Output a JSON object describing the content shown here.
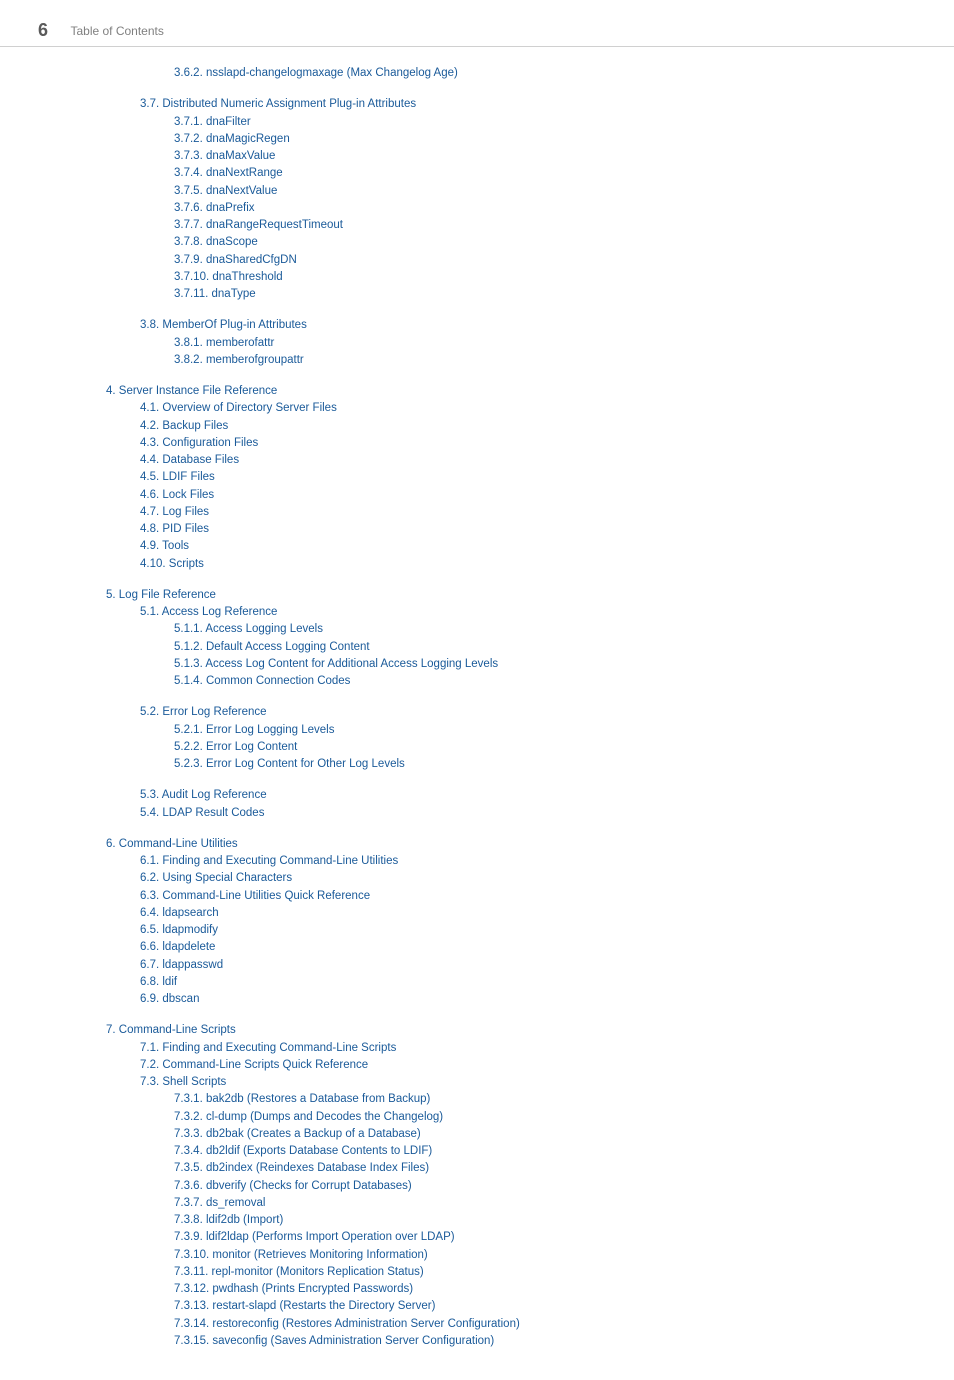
{
  "header": {
    "page_number": "6",
    "title": "Table of Contents"
  },
  "toc": [
    {
      "indent": 3,
      "gap": false,
      "text": "3.6.2. nsslapd-changelogmaxage (Max Changelog Age)"
    },
    {
      "indent": 2,
      "gap": true,
      "text": "3.7. Distributed Numeric Assignment Plug-in Attributes"
    },
    {
      "indent": 3,
      "gap": false,
      "text": "3.7.1. dnaFilter"
    },
    {
      "indent": 3,
      "gap": false,
      "text": "3.7.2. dnaMagicRegen"
    },
    {
      "indent": 3,
      "gap": false,
      "text": "3.7.3. dnaMaxValue"
    },
    {
      "indent": 3,
      "gap": false,
      "text": "3.7.4. dnaNextRange"
    },
    {
      "indent": 3,
      "gap": false,
      "text": "3.7.5. dnaNextValue"
    },
    {
      "indent": 3,
      "gap": false,
      "text": "3.7.6. dnaPrefix"
    },
    {
      "indent": 3,
      "gap": false,
      "text": "3.7.7. dnaRangeRequestTimeout"
    },
    {
      "indent": 3,
      "gap": false,
      "text": "3.7.8. dnaScope"
    },
    {
      "indent": 3,
      "gap": false,
      "text": "3.7.9. dnaSharedCfgDN"
    },
    {
      "indent": 3,
      "gap": false,
      "text": "3.7.10. dnaThreshold"
    },
    {
      "indent": 3,
      "gap": false,
      "text": "3.7.11. dnaType"
    },
    {
      "indent": 2,
      "gap": true,
      "text": "3.8. MemberOf Plug-in Attributes"
    },
    {
      "indent": 3,
      "gap": false,
      "text": "3.8.1. memberofattr"
    },
    {
      "indent": 3,
      "gap": false,
      "text": "3.8.2. memberofgroupattr"
    },
    {
      "indent": 1,
      "gap": true,
      "text": "4. Server Instance File Reference"
    },
    {
      "indent": 2,
      "gap": false,
      "text": "4.1. Overview of Directory Server Files"
    },
    {
      "indent": 2,
      "gap": false,
      "text": "4.2. Backup Files"
    },
    {
      "indent": 2,
      "gap": false,
      "text": "4.3. Configuration Files"
    },
    {
      "indent": 2,
      "gap": false,
      "text": "4.4. Database Files"
    },
    {
      "indent": 2,
      "gap": false,
      "text": "4.5. LDIF Files"
    },
    {
      "indent": 2,
      "gap": false,
      "text": "4.6. Lock Files"
    },
    {
      "indent": 2,
      "gap": false,
      "text": "4.7. Log Files"
    },
    {
      "indent": 2,
      "gap": false,
      "text": "4.8. PID Files"
    },
    {
      "indent": 2,
      "gap": false,
      "text": "4.9. Tools"
    },
    {
      "indent": 2,
      "gap": false,
      "text": "4.10. Scripts"
    },
    {
      "indent": 1,
      "gap": true,
      "text": "5. Log File Reference"
    },
    {
      "indent": 2,
      "gap": false,
      "text": "5.1. Access Log Reference"
    },
    {
      "indent": 3,
      "gap": false,
      "text": "5.1.1. Access Logging Levels"
    },
    {
      "indent": 3,
      "gap": false,
      "text": "5.1.2. Default Access Logging Content"
    },
    {
      "indent": 3,
      "gap": false,
      "text": "5.1.3. Access Log Content for Additional Access Logging Levels"
    },
    {
      "indent": 3,
      "gap": false,
      "text": "5.1.4. Common Connection Codes"
    },
    {
      "indent": 2,
      "gap": true,
      "text": "5.2. Error Log Reference"
    },
    {
      "indent": 3,
      "gap": false,
      "text": "5.2.1. Error Log Logging Levels"
    },
    {
      "indent": 3,
      "gap": false,
      "text": "5.2.2. Error Log Content"
    },
    {
      "indent": 3,
      "gap": false,
      "text": "5.2.3. Error Log Content for Other Log Levels"
    },
    {
      "indent": 2,
      "gap": true,
      "text": "5.3. Audit Log Reference"
    },
    {
      "indent": 2,
      "gap": false,
      "text": "5.4. LDAP Result Codes"
    },
    {
      "indent": 1,
      "gap": true,
      "text": "6. Command-Line Utilities"
    },
    {
      "indent": 2,
      "gap": false,
      "text": "6.1. Finding and Executing Command-Line Utilities"
    },
    {
      "indent": 2,
      "gap": false,
      "text": "6.2. Using Special Characters"
    },
    {
      "indent": 2,
      "gap": false,
      "text": "6.3. Command-Line Utilities Quick Reference"
    },
    {
      "indent": 2,
      "gap": false,
      "text": "6.4. ldapsearch"
    },
    {
      "indent": 2,
      "gap": false,
      "text": "6.5. ldapmodify"
    },
    {
      "indent": 2,
      "gap": false,
      "text": "6.6. ldapdelete"
    },
    {
      "indent": 2,
      "gap": false,
      "text": "6.7. ldappasswd"
    },
    {
      "indent": 2,
      "gap": false,
      "text": "6.8. ldif"
    },
    {
      "indent": 2,
      "gap": false,
      "text": "6.9. dbscan"
    },
    {
      "indent": 1,
      "gap": true,
      "text": "7. Command-Line Scripts"
    },
    {
      "indent": 2,
      "gap": false,
      "text": "7.1. Finding and Executing Command-Line Scripts"
    },
    {
      "indent": 2,
      "gap": false,
      "text": "7.2. Command-Line Scripts Quick Reference"
    },
    {
      "indent": 2,
      "gap": false,
      "text": "7.3. Shell Scripts"
    },
    {
      "indent": 3,
      "gap": false,
      "text": "7.3.1. bak2db (Restores a Database from Backup)"
    },
    {
      "indent": 3,
      "gap": false,
      "text": "7.3.2. cl-dump (Dumps and Decodes the Changelog)"
    },
    {
      "indent": 3,
      "gap": false,
      "text": "7.3.3. db2bak (Creates a Backup of a Database)"
    },
    {
      "indent": 3,
      "gap": false,
      "text": "7.3.4. db2ldif (Exports Database Contents to LDIF)"
    },
    {
      "indent": 3,
      "gap": false,
      "text": "7.3.5. db2index (Reindexes Database Index Files)"
    },
    {
      "indent": 3,
      "gap": false,
      "text": "7.3.6. dbverify (Checks for Corrupt Databases)"
    },
    {
      "indent": 3,
      "gap": false,
      "text": "7.3.7. ds_removal"
    },
    {
      "indent": 3,
      "gap": false,
      "text": "7.3.8. ldif2db (Import)"
    },
    {
      "indent": 3,
      "gap": false,
      "text": "7.3.9. ldif2ldap (Performs Import Operation over LDAP)"
    },
    {
      "indent": 3,
      "gap": false,
      "text": "7.3.10. monitor (Retrieves Monitoring Information)"
    },
    {
      "indent": 3,
      "gap": false,
      "text": "7.3.11. repl-monitor (Monitors Replication Status)"
    },
    {
      "indent": 3,
      "gap": false,
      "text": "7.3.12. pwdhash (Prints Encrypted Passwords)"
    },
    {
      "indent": 3,
      "gap": false,
      "text": "7.3.13. restart-slapd (Restarts the Directory Server)"
    },
    {
      "indent": 3,
      "gap": false,
      "text": "7.3.14. restoreconfig (Restores Administration Server Configuration)"
    },
    {
      "indent": 3,
      "gap": false,
      "text": "7.3.15. saveconfig (Saves Administration Server Configuration)"
    }
  ]
}
